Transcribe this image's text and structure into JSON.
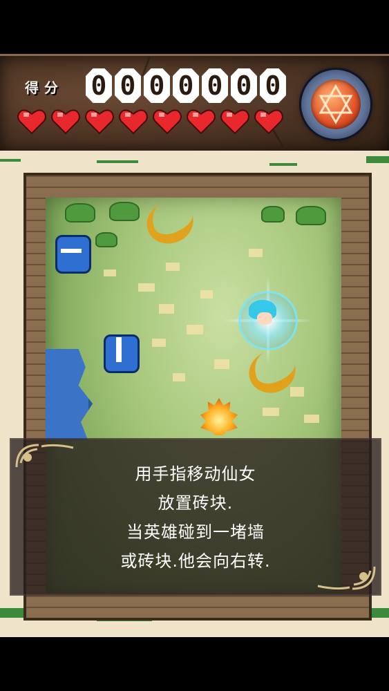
{
  "hud": {
    "score_label": "得分",
    "score_digits": [
      "0",
      "0",
      "0",
      "0",
      "0",
      "0",
      "0"
    ],
    "hearts_count": 8,
    "emblem_icon": "hexagram-icon",
    "colors": {
      "heart": "#e8282c",
      "hud_bg": "#4a3222",
      "emblem": "#e4572a"
    }
  },
  "tutorial": {
    "lines": [
      "用手指移动仙女",
      "放置砖块.",
      "当英雄碰到一堵墙",
      "或砖块.他会向右转."
    ]
  },
  "field": {
    "sprites": [
      "knight-enemy",
      "knight-hero",
      "fairy",
      "banana-peel",
      "fire-slime"
    ],
    "colors": {
      "grass": "#a6c77b",
      "water": "#3b74c6",
      "wall": "#7a5e44",
      "parchment": "#efe4c9"
    }
  }
}
